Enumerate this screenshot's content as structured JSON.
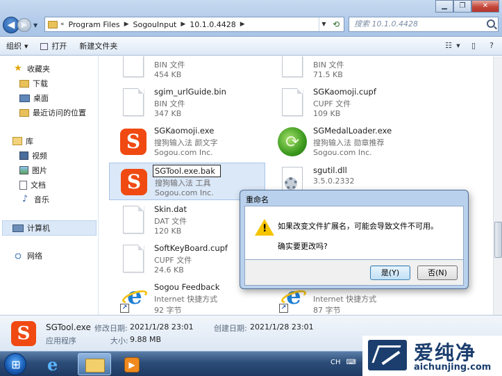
{
  "address": {
    "crumbs": [
      "Program Files",
      "SogouInput",
      "10.1.0.4428"
    ],
    "search_placeholder": "搜索 10.1.0.4428"
  },
  "toolbar": {
    "organize": "组织",
    "open": "打开",
    "new_folder": "新建文件夹"
  },
  "nav": {
    "favorites": "收藏夹",
    "downloads": "下载",
    "desktop": "桌面",
    "recent": "最近访问的位置",
    "libraries": "库",
    "videos": "视频",
    "pictures": "图片",
    "documents": "文档",
    "music": "音乐",
    "computer": "计算机",
    "network": "网络"
  },
  "files": {
    "f0": {
      "name": "",
      "line1": "BIN 文件",
      "line2": "454 KB"
    },
    "f1": {
      "name": "",
      "line1": "BIN 文件",
      "line2": "71.5 KB"
    },
    "f2": {
      "name": "sgim_urlGuide.bin",
      "line1": "BIN 文件",
      "line2": "347 KB"
    },
    "f3": {
      "name": "SGKaomoji.cupf",
      "line1": "CUPF 文件",
      "line2": "109 KB"
    },
    "f4": {
      "name": "SGKaomoji.exe",
      "line1": "搜狗输入法 颜文字",
      "line2": "Sogou.com Inc."
    },
    "f5": {
      "name": "SGMedalLoader.exe",
      "line1": "搜狗输入法 勋章推荐",
      "line2": "Sogou.com Inc."
    },
    "f6": {
      "name": "SGTool.exe.bak",
      "line1": "搜狗输入法 工具",
      "line2": "Sogou.com Inc."
    },
    "f7": {
      "name": "sgutil.dll",
      "line1": "3.5.0.2332",
      "line2": ""
    },
    "f8": {
      "name": "Skin.dat",
      "line1": "DAT 文件",
      "line2": "120 KB"
    },
    "f10": {
      "name": "SoftKeyBoard.cupf",
      "line1": "CUPF 文件",
      "line2": "24.6 KB"
    },
    "f12": {
      "name": "Sogou Feedback",
      "line1": "Internet 快捷方式",
      "line2": "92 字节"
    },
    "f13": {
      "name": "",
      "line1": "Internet 快捷方式",
      "line2": "87 字节"
    }
  },
  "details": {
    "name": "SGTool.exe",
    "modified_label": "修改日期:",
    "modified_value": "2021/1/28 23:01",
    "created_label": "创建日期:",
    "created_value": "2021/1/28 23:01",
    "type": "应用程序",
    "size_label": "大小:",
    "size_value": "9.88 MB"
  },
  "dialog": {
    "title": "重命名",
    "message": "如果改变文件扩展名，可能会导致文件不可用。",
    "question": "确实要更改吗?",
    "yes": "是(Y)",
    "no": "否(N)"
  },
  "tray": {
    "lang": "CH"
  },
  "watermark": {
    "cn": "爱纯净",
    "en": "aichunjing.com"
  },
  "colors": {
    "sogou": "#f04a12",
    "selection": "#dbe8f8",
    "dialog_frame": "#b9d1ec"
  }
}
